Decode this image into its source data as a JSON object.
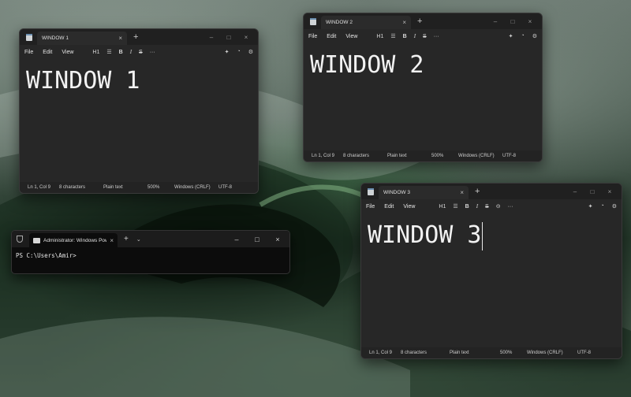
{
  "windows": [
    {
      "tab_title": "WINDOW 1",
      "content": "WINDOW 1",
      "menu": [
        "File",
        "Edit",
        "View"
      ],
      "heading": "H1",
      "status": {
        "position": "Ln 1, Col 9",
        "chars": "8 characters",
        "format": "Plain text",
        "zoom": "500%",
        "line_ending": "Windows (CRLF)",
        "encoding": "UTF-8"
      }
    },
    {
      "tab_title": "WINDOW 2",
      "content": "WINDOW 2",
      "menu": [
        "File",
        "Edit",
        "View"
      ],
      "heading": "H1",
      "status": {
        "position": "Ln 1, Col 9",
        "chars": "8 characters",
        "format": "Plain text",
        "zoom": "500%",
        "line_ending": "Windows (CRLF)",
        "encoding": "UTF-8"
      }
    },
    {
      "tab_title": "WINDOW 3",
      "content": "WINDOW 3",
      "menu": [
        "File",
        "Edit",
        "View"
      ],
      "heading": "H1",
      "status": {
        "position": "Ln 1, Col 9",
        "chars": "8 characters",
        "format": "Plain text",
        "zoom": "500%",
        "line_ending": "Windows (CRLF)",
        "encoding": "UTF-8"
      }
    }
  ],
  "terminal": {
    "tab_title": "Administrator: Windows Pow",
    "prompt": "PS C:\\Users\\Amir>"
  },
  "icons": {
    "tab_close": "×",
    "new_tab": "+",
    "minimize": "–",
    "maximize": "□",
    "close": "×",
    "list": "☰",
    "chevron": "⌄",
    "bold": "B",
    "italic": "I",
    "strike": "S",
    "link": "⊝",
    "more": "···",
    "gear": "⚙"
  }
}
